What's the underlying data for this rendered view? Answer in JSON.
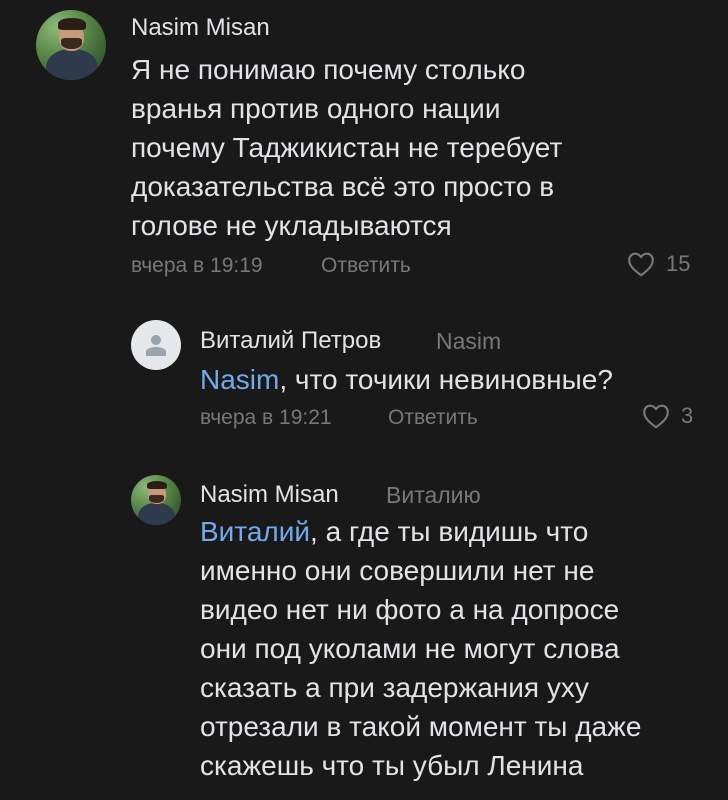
{
  "comments": [
    {
      "author": "Nasim Misan",
      "reply_to": "",
      "mention": "",
      "text_lines": [
        "Я не понимаю почему столько",
        "вранья против одного нации",
        "почему Таджикистан не теребует",
        "доказательства всё это просто в",
        "голове не укладываются"
      ],
      "timestamp": "вчера в 19:19",
      "reply_label": "Ответить",
      "likes": "15",
      "avatar": "user-photo"
    },
    {
      "author": "Виталий Петров",
      "reply_to": "Nasim",
      "mention": "Nasim",
      "text_after_mention": ", что точики невиновные?",
      "timestamp": "вчера в 19:21",
      "reply_label": "Ответить",
      "likes": "3",
      "avatar": "placeholder-user-icon"
    },
    {
      "author": "Nasim Misan",
      "reply_to": "Виталию",
      "mention": "Виталий",
      "first_line_rest": ", а где ты видишь что",
      "text_lines": [
        "именно они совершили нет не",
        "видео нет ни фото а на допросе",
        "они под уколами не могут слова",
        "сказать а при задержания уху",
        "отрезали в такой момент ты даже",
        "скажешь что ты убыл Ленина"
      ],
      "avatar": "user-photo"
    }
  ],
  "colors": {
    "background": "#19191a",
    "text": "#e1e3e6",
    "secondary": "#76787a",
    "mention": "#71aaeb"
  }
}
